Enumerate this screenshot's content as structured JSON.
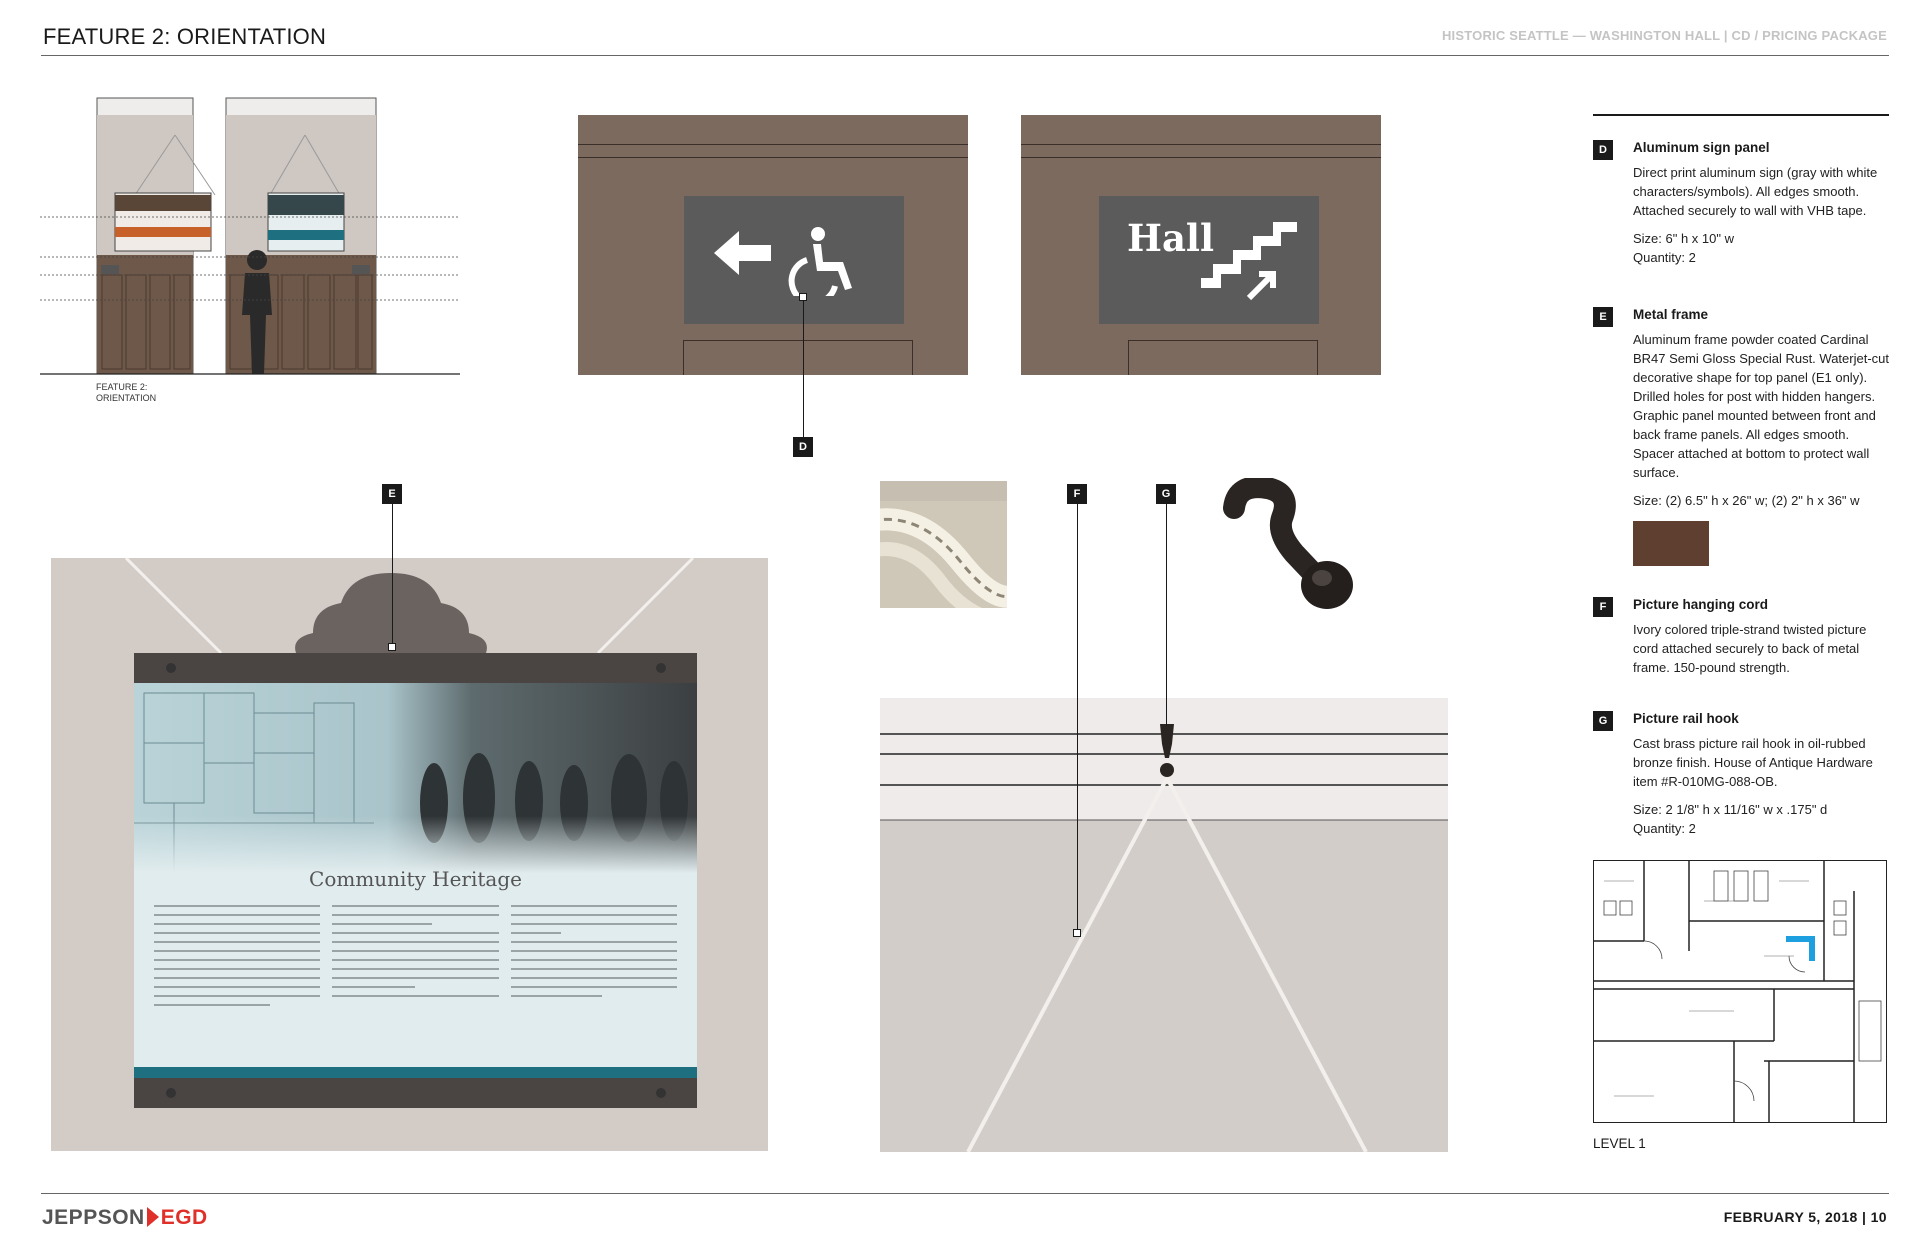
{
  "header": {
    "title": "FEATURE 2: ORIENTATION",
    "project": "HISTORIC SEATTLE — WASHINGTON HALL | CD / PRICING PACKAGE"
  },
  "footer": {
    "logo_part1": "JEPPSON",
    "logo_part2": "EGD",
    "date_page": "FEBRUARY 5, 2018 | 10"
  },
  "elevation": {
    "label_line1": "FEATURE 2:",
    "label_line2": "ORIENTATION"
  },
  "callouts": {
    "d": "D",
    "e": "E",
    "f": "F",
    "g": "G"
  },
  "signs": {
    "hall_text": "Hall"
  },
  "panel": {
    "title": "Community Heritage"
  },
  "specs": [
    {
      "code": "D",
      "title": "Aluminum sign panel",
      "description": "Direct print aluminum sign (gray with white characters/symbols). All edges smooth. Attached securely to wall with VHB tape.",
      "size": "Size: 6\" h x 10\" w",
      "quantity": "Quantity: 2"
    },
    {
      "code": "E",
      "title": "Metal frame",
      "description": "Aluminum frame powder coated Cardinal BR47 Semi Gloss Special Rust. Waterjet-cut decorative shape for top panel (E1 only). Drilled holes for post with hidden hangers. Graphic panel mounted between front and back frame panels. All edges smooth. Spacer attached at bottom to protect wall surface.",
      "size": "Size: (2) 6.5\" h x 26\" w; (2) 2\" h x 36\" w",
      "swatch_color": "#5e3f30"
    },
    {
      "code": "F",
      "title": "Picture hanging cord",
      "description": "Ivory colored triple-strand twisted picture cord attached securely to back of metal frame. 150-pound strength."
    },
    {
      "code": "G",
      "title": "Picture rail hook",
      "description": "Cast brass picture rail hook in oil-rubbed bronze finish. House of Antique Hardware item #R-010MG-088-OB.",
      "size": "Size: 2 1/8\" h x 11/16\" w x .175\" d",
      "quantity": "Quantity: 2"
    }
  ],
  "floorplan": {
    "label": "LEVEL 1",
    "highlight_color": "#1ea0e0"
  },
  "colors": {
    "sign_gray": "#5b5b5b",
    "wall_brown": "#7d6a5e",
    "frame_rust": "#5e3f30",
    "teal": "#1e6f80",
    "logo_red": "#e0302a"
  }
}
